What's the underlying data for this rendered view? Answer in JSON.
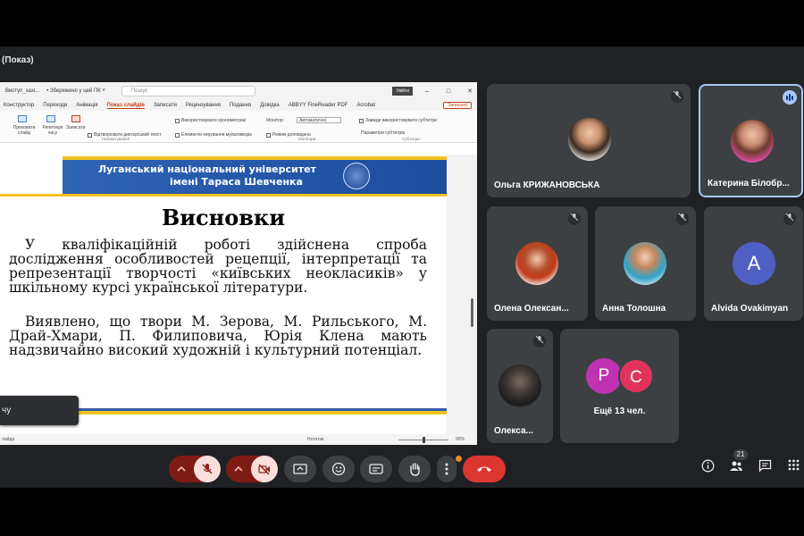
{
  "window": {
    "title": "(Показ)"
  },
  "powerpoint": {
    "title_doc": "Виступ_захі...",
    "title_saved": "• Збережено у цей ПК ˅",
    "search_placeholder": "Пошук",
    "signin": "Увійти",
    "tabs": [
      "Конструктор",
      "Переходи",
      "Анімація",
      "Показ слайдів",
      "Записати",
      "Рецензування",
      "Подання",
      "Довідка",
      "ABBYY FineReader PDF",
      "Acrobat"
    ],
    "active_tab_index": 3,
    "record_button": "Записати",
    "ribbon": {
      "hide_slide": "Приховати слайд",
      "rehearse": "Репетиція часу",
      "record": "Записати",
      "use_timings": "Використовувати хронометраж",
      "play_narrations": "Відтворювати дикторський текст",
      "show_media": "Елементи керування мультимедіа",
      "monitor_label": "Монітор:",
      "monitor_value": "Автоматично",
      "presenter_view": "Режим доповідача",
      "always_subtitles": "Завжди використовувати субтитри",
      "subtitle_settings": "Параметри субтитрів",
      "group_setup": "Налаштування",
      "group_monitors": "Монітори",
      "group_captions": "Субтитри"
    },
    "status_notes": "Нотатки",
    "status_zoom": "90%",
    "status_left": "лайда"
  },
  "slide": {
    "university_line1": "Луганський національний університет",
    "university_line2": "імені Тараса Шевченка",
    "heading": "Висновки",
    "para1": "У кваліфікаційній роботі здійснена спроба дослідження особливостей рецепції, інтерпретації та репрезентації творчості «київських неокласиків» у шкільному курсі української літератури.",
    "para2": "Виявлено, що твори М. Зерова, М. Рильського, М. Драй-Хмари, П. Филиповича, Юрія Клена мають надзвичайно високий художній і культурний потенціал."
  },
  "toast": {
    "text": "чу"
  },
  "participants": [
    {
      "name": "Ольга КРИЖАНОВСЬКА",
      "muted": true
    },
    {
      "name": "Катерина Білобр...",
      "speaking": true
    },
    {
      "name": "Олена Олексан...",
      "muted": true
    },
    {
      "name": "Анна Толошна",
      "muted": true
    },
    {
      "name": "Alvida Ovakimyan",
      "muted": true,
      "initial": "A",
      "color": "#4f5fc4"
    },
    {
      "name": "Олекса...",
      "muted": true
    }
  ],
  "more_tile": {
    "label": "Ещё 13 чел.",
    "initials": [
      "P",
      "C"
    ],
    "colors": [
      "#c032b4",
      "#e0345c"
    ]
  },
  "controls": {
    "people_count": "21",
    "icons": [
      "chevron-up-icon",
      "mic-off-icon",
      "chevron-up-icon",
      "camera-off-icon",
      "present-icon",
      "emoji-icon",
      "captions-icon",
      "raise-hand-icon",
      "more-icon",
      "hang-up-icon",
      "info-icon",
      "people-icon",
      "chat-icon",
      "apps-icon"
    ]
  }
}
